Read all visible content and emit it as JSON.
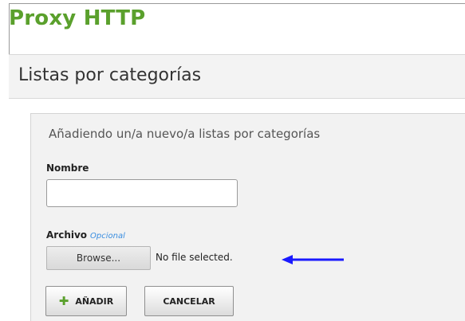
{
  "header": {
    "title": "Proxy HTTP"
  },
  "section": {
    "title": "Listas por categorías"
  },
  "form": {
    "heading": "Añadiendo un/a nuevo/a listas por categorías",
    "name_label": "Nombre",
    "name_value": "",
    "file_label": "Archivo",
    "file_optional": "Opcional",
    "browse_label": "Browse...",
    "file_status": "No file selected.",
    "add_label": "AÑADIR",
    "cancel_label": "CANCELAR"
  },
  "annotation": {
    "arrow_color": "#1a1aff"
  },
  "colors": {
    "brand_green": "#5aa02c",
    "optional_blue": "#3a8ee0"
  }
}
